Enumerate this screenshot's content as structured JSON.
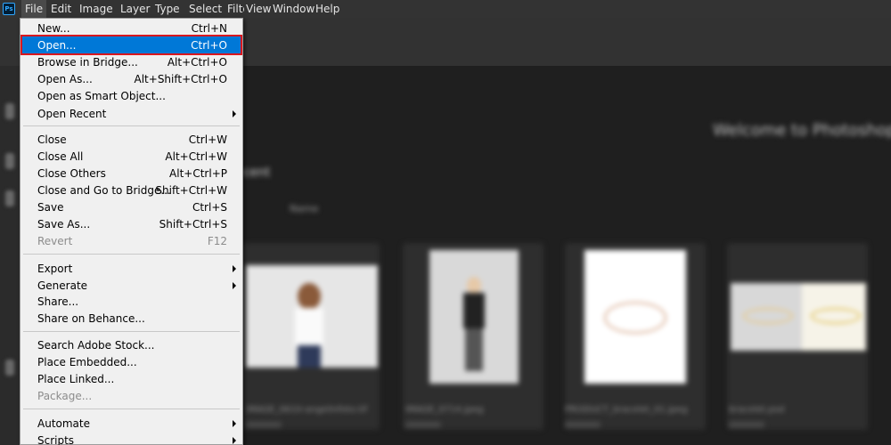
{
  "app": {
    "logo_text": "Ps",
    "menus": [
      "File",
      "Edit",
      "Image",
      "Layer",
      "Type",
      "Select",
      "Filter",
      "View",
      "Window",
      "Help"
    ]
  },
  "workspace": {
    "welcome_text": "Welcome to Photoshop",
    "recent_heading": "Recent",
    "sort_label": "Name",
    "files": [
      {
        "caption": "IMAGE_0610-angelinfoto.tif"
      },
      {
        "caption": "IMAGE_0714.jpeg"
      },
      {
        "caption": "PRODUCT_bracelet_01.jpeg"
      },
      {
        "caption": "bracelet.psd"
      }
    ]
  },
  "file_menu": {
    "items": [
      {
        "label": "New...",
        "shortcut": "Ctrl+N"
      },
      {
        "label": "Open...",
        "shortcut": "Ctrl+O",
        "highlighted": true
      },
      {
        "label": "Browse in Bridge...",
        "shortcut": "Alt+Ctrl+O"
      },
      {
        "label": "Open As...",
        "shortcut": "Alt+Shift+Ctrl+O"
      },
      {
        "label": "Open as Smart Object...",
        "shortcut": ""
      },
      {
        "label": "Open Recent",
        "shortcut": "",
        "submenu": true
      },
      {
        "label": "Close",
        "shortcut": "Ctrl+W"
      },
      {
        "label": "Close All",
        "shortcut": "Alt+Ctrl+W"
      },
      {
        "label": "Close Others",
        "shortcut": "Alt+Ctrl+P"
      },
      {
        "label": "Close and Go to Bridge...",
        "shortcut": "Shift+Ctrl+W"
      },
      {
        "label": "Save",
        "shortcut": "Ctrl+S"
      },
      {
        "label": "Save As...",
        "shortcut": "Shift+Ctrl+S"
      },
      {
        "label": "Revert",
        "shortcut": "F12",
        "disabled": true
      },
      {
        "label": "Export",
        "shortcut": "",
        "submenu": true
      },
      {
        "label": "Generate",
        "shortcut": "",
        "submenu": true
      },
      {
        "label": "Share...",
        "shortcut": ""
      },
      {
        "label": "Share on Behance...",
        "shortcut": ""
      },
      {
        "label": "Search Adobe Stock...",
        "shortcut": ""
      },
      {
        "label": "Place Embedded...",
        "shortcut": ""
      },
      {
        "label": "Place Linked...",
        "shortcut": ""
      },
      {
        "label": "Package...",
        "shortcut": "",
        "disabled": true
      },
      {
        "label": "Automate",
        "shortcut": "",
        "submenu": true
      },
      {
        "label": "Scripts",
        "shortcut": "",
        "submenu": true
      }
    ]
  },
  "colors": {
    "menu_highlight": "#0078d7",
    "highlight_outline": "#d9171e",
    "menu_background": "#f0f0f0",
    "app_background": "#1f1f1f"
  }
}
